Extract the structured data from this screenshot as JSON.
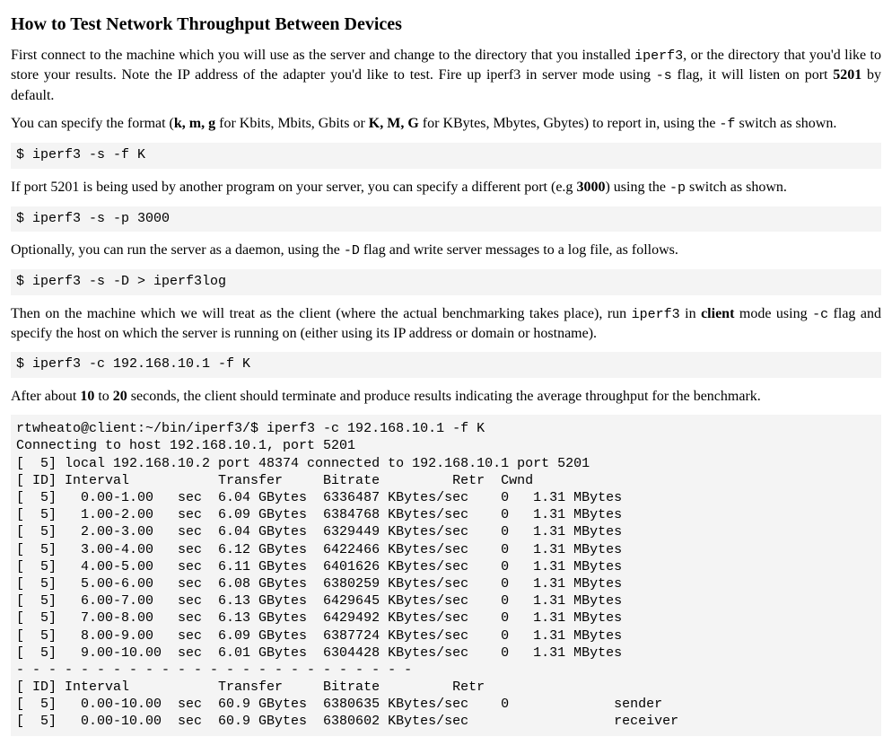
{
  "title": "How to Test Network Throughput Between Devices",
  "paragraphs": {
    "p1_a": "First connect to the machine which you will use as the server and change to the directory that you installed ",
    "p1_code1": "iperf3",
    "p1_b": ", or the directory that you'd like to store your results. Note the IP address of the adapter you'd like to test. Fire up iperf3 in server mode using ",
    "p1_code2": "-s",
    "p1_c": " flag, it will listen on port ",
    "p1_bold": "5201",
    "p1_d": " by default.",
    "p2_a": "You can specify the format (",
    "p2_b1": "k, m, g",
    "p2_b": " for Kbits, Mbits, Gbits or ",
    "p2_b2": "K, M, G",
    "p2_c": " for KBytes, Mbytes, Gbytes) to report in, using the ",
    "p2_code": "-f",
    "p2_d": " switch as shown.",
    "p3_a": "If port 5201 is being used by another program on your server, you can specify a different port (e.g ",
    "p3_b1": "3000",
    "p3_b": ") using the ",
    "p3_code": "-p",
    "p3_c": " switch as shown.",
    "p4_a": "Optionally, you can run the server as a daemon, using the ",
    "p4_code": "-D",
    "p4_b": " flag and write server messages to a log file, as follows.",
    "p5_a": "Then on the machine which we will treat as the client (where the actual benchmarking takes place), run ",
    "p5_code1": "iperf3",
    "p5_b": " in ",
    "p5_bold": "client",
    "p5_c": " mode using ",
    "p5_code2": "-c",
    "p5_d": " flag and specify the host on which the server is running on (either using its IP address or domain or hostname).",
    "p6_a": "After about ",
    "p6_b1": "10",
    "p6_b": " to ",
    "p6_b2": "20",
    "p6_c": " seconds, the client should terminate and produce results indicating the average throughput for the benchmark."
  },
  "commands": {
    "cmd1": "$ iperf3 -s -f K",
    "cmd2": "$ iperf3 -s -p 3000",
    "cmd3": "$ iperf3 -s -D > iperf3log",
    "cmd4": "$ iperf3 -c 192.168.10.1 -f K"
  },
  "output": "rtwheato@client:~/bin/iperf3/$ iperf3 -c 192.168.10.1 -f K\nConnecting to host 192.168.10.1, port 5201\n[  5] local 192.168.10.2 port 48374 connected to 192.168.10.1 port 5201\n[ ID] Interval           Transfer     Bitrate         Retr  Cwnd\n[  5]   0.00-1.00   sec  6.04 GBytes  6336487 KBytes/sec    0   1.31 MBytes\n[  5]   1.00-2.00   sec  6.09 GBytes  6384768 KBytes/sec    0   1.31 MBytes\n[  5]   2.00-3.00   sec  6.04 GBytes  6329449 KBytes/sec    0   1.31 MBytes\n[  5]   3.00-4.00   sec  6.12 GBytes  6422466 KBytes/sec    0   1.31 MBytes\n[  5]   4.00-5.00   sec  6.11 GBytes  6401626 KBytes/sec    0   1.31 MBytes\n[  5]   5.00-6.00   sec  6.08 GBytes  6380259 KBytes/sec    0   1.31 MBytes\n[  5]   6.00-7.00   sec  6.13 GBytes  6429645 KBytes/sec    0   1.31 MBytes\n[  5]   7.00-8.00   sec  6.13 GBytes  6429492 KBytes/sec    0   1.31 MBytes\n[  5]   8.00-9.00   sec  6.09 GBytes  6387724 KBytes/sec    0   1.31 MBytes\n[  5]   9.00-10.00  sec  6.01 GBytes  6304428 KBytes/sec    0   1.31 MBytes\n- - - - - - - - - - - - - - - - - - - - - - - - -\n[ ID] Interval           Transfer     Bitrate         Retr\n[  5]   0.00-10.00  sec  60.9 GBytes  6380635 KBytes/sec    0             sender\n[  5]   0.00-10.00  sec  60.9 GBytes  6380602 KBytes/sec                  receiver"
}
